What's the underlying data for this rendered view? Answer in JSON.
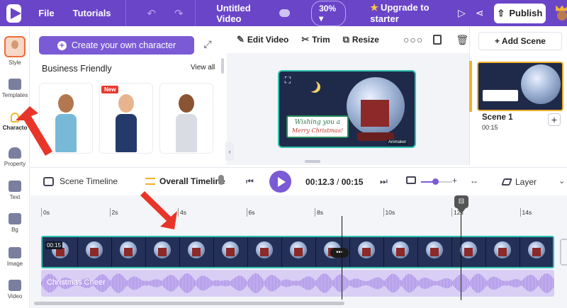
{
  "topbar": {
    "file_label": "File",
    "tutorials_label": "Tutorials",
    "undo_icon": "↶",
    "redo_icon": "↷",
    "project_title": "Untitled Video",
    "zoom_value": "30%",
    "upgrade_label": "Upgrade to starter",
    "upgrade_icon": "★",
    "play_icon": "▷",
    "share_icon": "⋖",
    "publish_label": "Publish",
    "publish_icon": "⇧"
  },
  "rail": {
    "items": [
      {
        "label": "Style"
      },
      {
        "label": "Templates"
      },
      {
        "label": "Characto"
      },
      {
        "label": "Property"
      },
      {
        "label": "Text"
      },
      {
        "label": "Bg"
      },
      {
        "label": "Image"
      },
      {
        "label": "Video"
      }
    ]
  },
  "character_panel": {
    "create_label": "Create your own character",
    "create_icon": "+",
    "expand_icon": "⤢",
    "section_title": "Business Friendly",
    "view_all_label": "View all",
    "new_badge": "New",
    "collapse_icon": "‹"
  },
  "edit_toolbar": {
    "edit_label": "Edit Video",
    "edit_icon": "✎",
    "trim_label": "Trim",
    "trim_icon": "✂",
    "resize_label": "Resize",
    "resize_icon": "⧉",
    "more_icon": "○○○",
    "trash_icon": "🗑"
  },
  "canvas": {
    "card_line1": "Wishing you a",
    "card_line2": "Merry Christmas!",
    "select_icon": "⛶",
    "tag": "Animaker"
  },
  "scenes": {
    "add_label": "+ Add Scene",
    "scene_name": "Scene 1",
    "scene_duration": "00:15",
    "add_icon": "+"
  },
  "timeline_toolbar": {
    "scene_timeline_label": "Scene Timeline",
    "overall_timeline_label": "Overall Timeline",
    "prev_icon": "⏮",
    "current_time": "00:12.3",
    "time_separator": "/",
    "total_time": "00:15",
    "next_icon": "⏭",
    "plus_icon": "+",
    "fit_icon": "↔",
    "layer_label": "Layer",
    "chevron_icon": "⌄",
    "zoom_level": 0.45
  },
  "timeline": {
    "ticks": [
      "0s",
      "2s",
      "4s",
      "6s",
      "8s",
      "10s",
      "12s",
      "14s"
    ],
    "video_label": "00:15",
    "more_label": "•••",
    "audio_label": "Christmas Cheer",
    "playhead_icon": "⊟"
  },
  "colors": {
    "brand": "#6a45c8",
    "accent": "#7b5ad6",
    "selection": "#2fc2b0",
    "scene_highlight": "#f0b12a",
    "annotation_arrow": "#e8352a"
  }
}
